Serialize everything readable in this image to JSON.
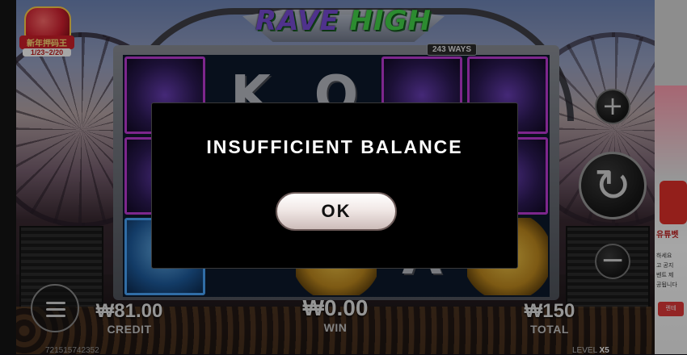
{
  "game": {
    "title_part1": "RAVE",
    "title_part2": "HIGH",
    "ways_badge": "243 WAYS"
  },
  "promo": {
    "title": "新年押码王",
    "dates": "1/23~2/20"
  },
  "reels": {
    "letters": [
      "K",
      "Q",
      "A"
    ]
  },
  "controls": {
    "plus_glyph": "+",
    "minus_glyph": "−",
    "spin_glyph": "↻"
  },
  "bottom_bar": {
    "credit_value": "₩81.00",
    "credit_label": "CREDIT",
    "win_value": "₩0.00",
    "win_label": "WIN",
    "total_value": "₩150",
    "total_label": "TOTAL",
    "round_id": "721515742352",
    "level_label": "LEVEL",
    "level_value": "X5"
  },
  "ad": {
    "title": "유튜벳",
    "line1": "하세요",
    "line2": "고 공지",
    "line3": "벤트 제",
    "line4": "공됩니다",
    "button": "렌테"
  },
  "dialog": {
    "message": "INSUFFICIENT BALANCE",
    "ok_label": "OK"
  }
}
